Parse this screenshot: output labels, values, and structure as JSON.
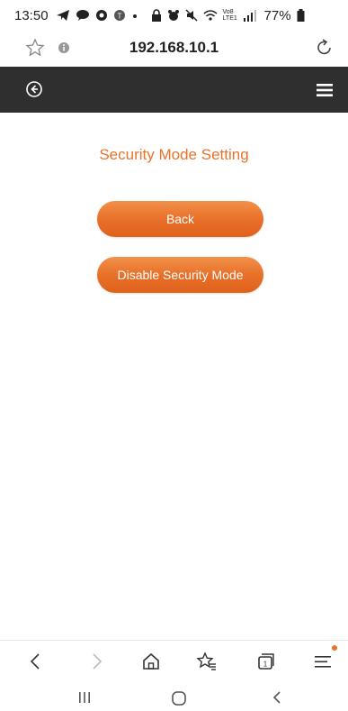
{
  "status_bar": {
    "time": "13:50",
    "battery": "77%",
    "network_label": "Vo8 LTE1"
  },
  "address_bar": {
    "url": "192.168.10.1"
  },
  "main": {
    "title": "Security Mode Setting",
    "back_button_label": "Back",
    "disable_button_label": "Disable Security Mode"
  },
  "colors": {
    "accent": "#e8732b",
    "header_bg": "#2f2f2f"
  },
  "icons": {
    "header_left": "back-circle-icon",
    "header_right": "hamburger-menu-icon",
    "browser_toolbar": [
      "back-icon",
      "forward-icon",
      "home-icon",
      "bookmarks-icon",
      "tabs-icon",
      "menu-icon"
    ],
    "tabs_count": "1"
  }
}
